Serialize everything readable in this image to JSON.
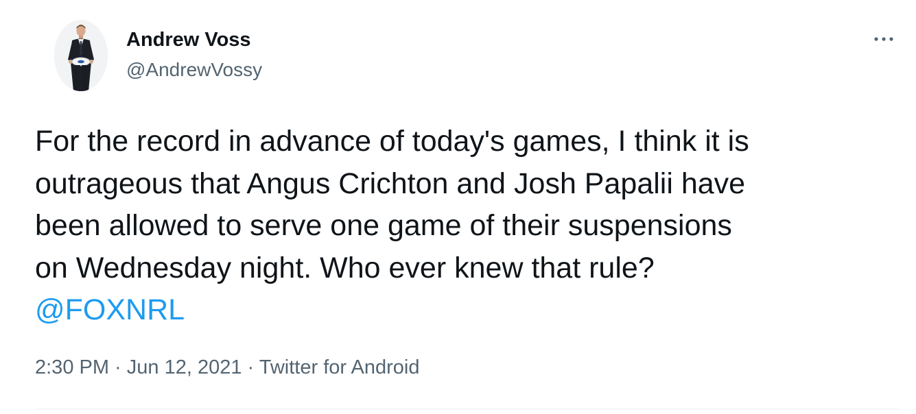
{
  "author": {
    "display_name": "Andrew Voss",
    "handle": "@AndrewVossy"
  },
  "tweet": {
    "text_lines": [
      "For the record in advance of today's games, I think it is",
      "outrageous that Angus Crichton and Josh Papalii have",
      "been allowed to serve one game of their suspensions",
      "on Wednesday night. Who ever knew that rule?"
    ],
    "mention": "@FOXNRL"
  },
  "meta": {
    "time": "2:30 PM",
    "separator": " · ",
    "date": "Jun 12, 2021",
    "source": "Twitter for Android"
  },
  "icons": {
    "more": "more-options-icon",
    "avatar": "profile-photo"
  },
  "colors": {
    "text": "#0f1419",
    "secondary": "#536471",
    "link": "#1d9bf0"
  }
}
